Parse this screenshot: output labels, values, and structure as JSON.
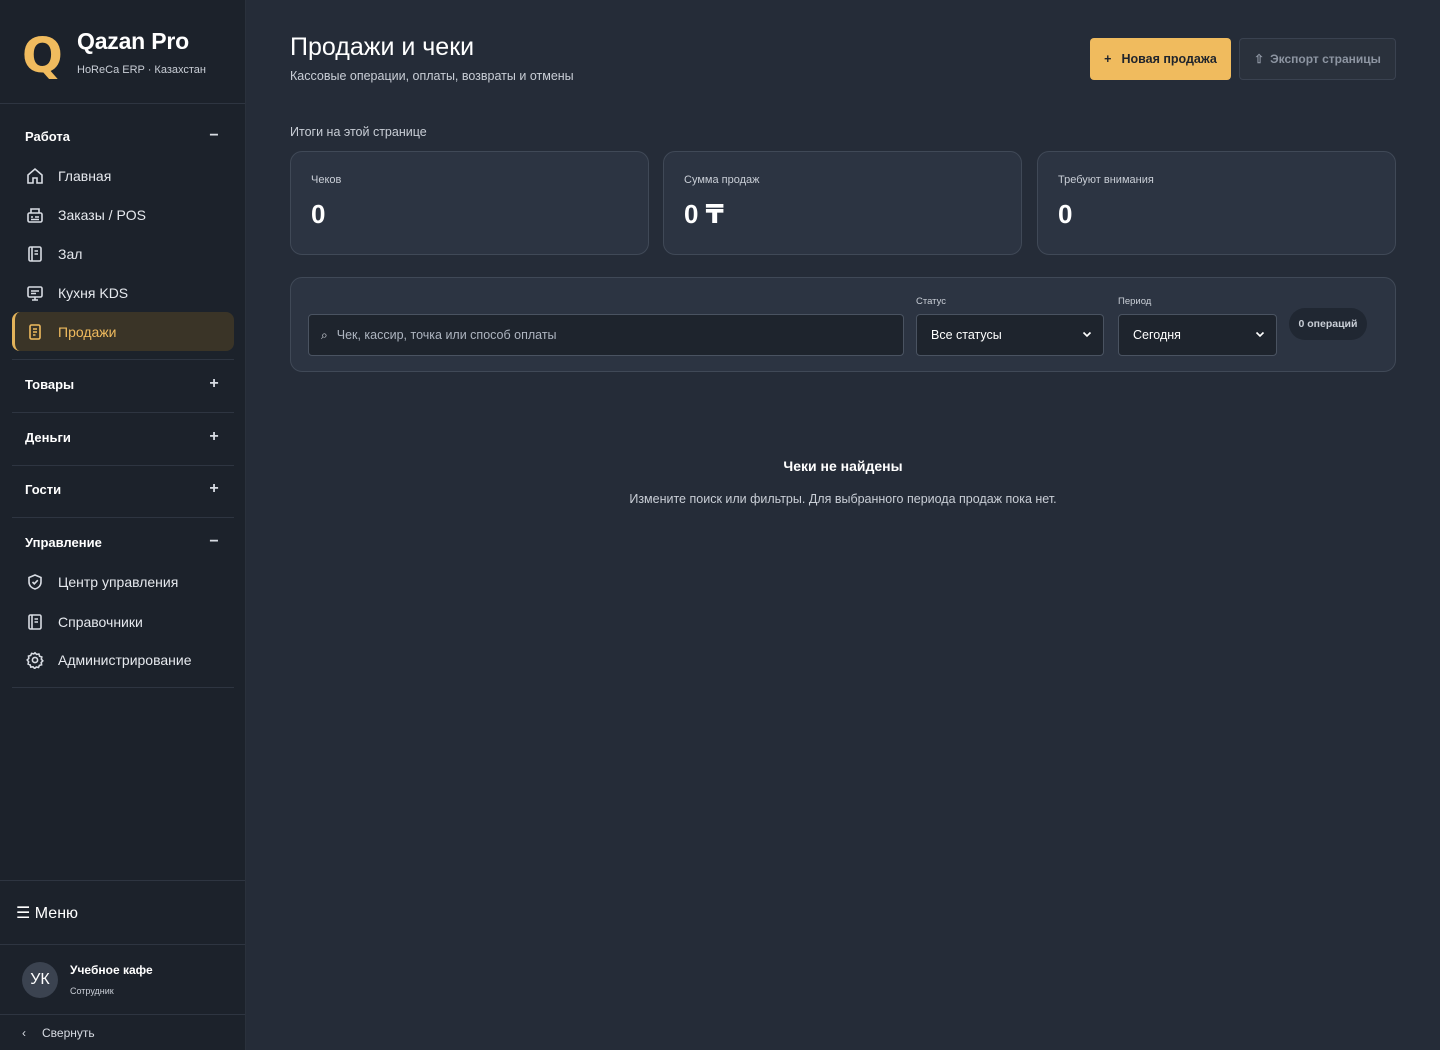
{
  "brand": {
    "logo_letter": "Q",
    "title": "Qazan Pro",
    "subtitle": "HoReCa ERP · Казахстан"
  },
  "sidebar": {
    "sections": [
      {
        "label": "Работа",
        "toggle": "−",
        "items": [
          {
            "label": "Главная",
            "icon": "home-icon"
          },
          {
            "label": "Заказы / POS",
            "icon": "pos-icon"
          },
          {
            "label": "Зал",
            "icon": "notebook-icon"
          },
          {
            "label": "Кухня KDS",
            "icon": "monitor-icon"
          },
          {
            "label": "Продажи",
            "icon": "receipt-icon",
            "active": true
          }
        ]
      },
      {
        "label": "Товары",
        "toggle": "+"
      },
      {
        "label": "Деньги",
        "toggle": "+"
      },
      {
        "label": "Гости",
        "toggle": "+"
      },
      {
        "label": "Управление",
        "toggle": "−",
        "items": [
          {
            "label": "Центр управления",
            "icon": "shield-check-icon"
          },
          {
            "label": "Справочники",
            "icon": "notebook-icon"
          },
          {
            "label": "Администрирование",
            "icon": "gear-icon"
          }
        ]
      }
    ],
    "menu_label": "☰ Меню",
    "user": {
      "initials": "УК",
      "name": "Учебное кафе",
      "role": "Сотрудник"
    },
    "collapse_label": "Свернуть"
  },
  "header": {
    "title": "Продажи и чеки",
    "subtitle": "Кассовые операции, оплаты, возвраты и отмены",
    "new_sale_label": "Новая продажа",
    "export_label": "Экспорт страницы"
  },
  "totals": {
    "label": "Итоги на этой странице",
    "cards": [
      {
        "label": "Чеков",
        "value": "0"
      },
      {
        "label": "Сумма продаж",
        "value": "0 ₸"
      },
      {
        "label": "Требуют внимания",
        "value": "0"
      }
    ]
  },
  "filters": {
    "search_placeholder": "Чек, кассир, точка или способ оплаты",
    "status_label": "Статус",
    "status_value": "Все статусы",
    "period_label": "Период",
    "period_value": "Сегодня",
    "ops_count": "0 операций"
  },
  "empty": {
    "title": "Чеки не найдены",
    "subtitle": "Измените поиск или фильтры. Для выбранного периода продаж пока нет."
  },
  "colors": {
    "accent": "#f0bb5e",
    "background": "#252c38",
    "sidebar": "#1c222b",
    "card": "#2c3442"
  }
}
